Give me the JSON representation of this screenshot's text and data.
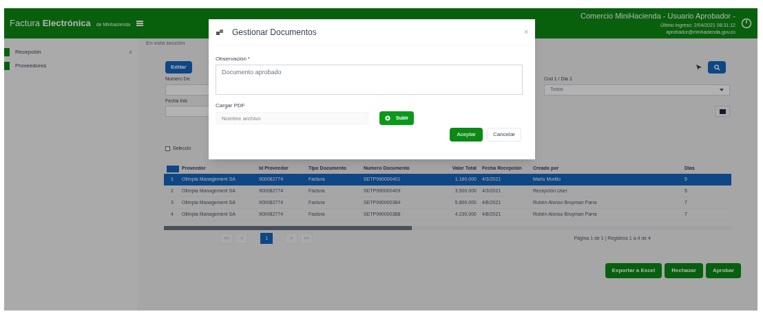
{
  "header": {
    "brand_light": "Factura",
    "brand_bold": "Electrónica",
    "brand_sub": "de Minhacienda",
    "user_title": "Comercio MiniHacienda - Usuario Aprobador -",
    "user_line_1": "Último ingreso: 2/04/2021 08:31:12",
    "user_line_2": "aprobador@minhacienda.gov.co"
  },
  "breadcrumb": "En esta sección",
  "sidebar": {
    "items": [
      {
        "label": "Recepción"
      },
      {
        "label": "Proveedores"
      }
    ]
  },
  "toolbar": {
    "edit_button": "Editar"
  },
  "filters": {
    "label_1": "Numero De",
    "label_2": "Fecha Inic",
    "label_3": "Cod 1 / Dia 1",
    "select_value": "Todos",
    "select_all": {
      "label": "Seleccio",
      "checked": false
    }
  },
  "table": {
    "columns": [
      "Proveedor",
      "Id Proveedor",
      "Tipo Documento",
      "Numero Documento",
      "Valor Total",
      "Fecha Recepción",
      "Creado por",
      "Dias"
    ],
    "rows": [
      {
        "selected": true,
        "number": "1",
        "cells": [
          "Olimpia Management SA",
          "900082774",
          "Factura",
          "SETP990000401",
          "1.160.000",
          "4/3/2021",
          "Mario Murillo",
          "5"
        ]
      },
      {
        "selected": false,
        "number": "2",
        "cells": [
          "Olimpia Management SA",
          "900082774",
          "Factura",
          "SETP990000409",
          "3.500.000",
          "4/3/2021",
          "Recepción User",
          "5"
        ]
      },
      {
        "selected": false,
        "number": "3",
        "cells": [
          "Olimpia Management SA",
          "900082774",
          "Factura",
          "SETP990000384",
          "5.800.000",
          "4/8/2021",
          "Rubén Alonso Bruyman Parra",
          "7"
        ]
      },
      {
        "selected": false,
        "number": "4",
        "cells": [
          "Olimpia Management SA",
          "900082774",
          "Factura",
          "SETP990000388",
          "4.230.000",
          "4/8/2021",
          "Rubén Alonso Bruyman Parra",
          "7"
        ]
      }
    ]
  },
  "pagination": {
    "pages": [
      {
        "label": "<<",
        "selected": false
      },
      {
        "label": "<",
        "selected": false
      },
      {
        "label": "1",
        "selected": true
      },
      {
        "label": ">",
        "selected": false
      },
      {
        "label": ">>",
        "selected": false
      }
    ],
    "summary": "Página 1 de 1 | Registros 1 a 4 de 4"
  },
  "actions": [
    "Exportar a Excel",
    "Rechazar",
    "Aprobar"
  ],
  "modal": {
    "title": "Gestionar Documentos",
    "close": "×",
    "observation_label": "Observación",
    "required_mark": "*",
    "observation_value": "Documento aprobado",
    "upload_label": "Cargar PDF",
    "file_placeholder": "Nombre archivo",
    "upload_button": "Subir",
    "accept": "Aceptar",
    "cancel": "Cancelar"
  }
}
